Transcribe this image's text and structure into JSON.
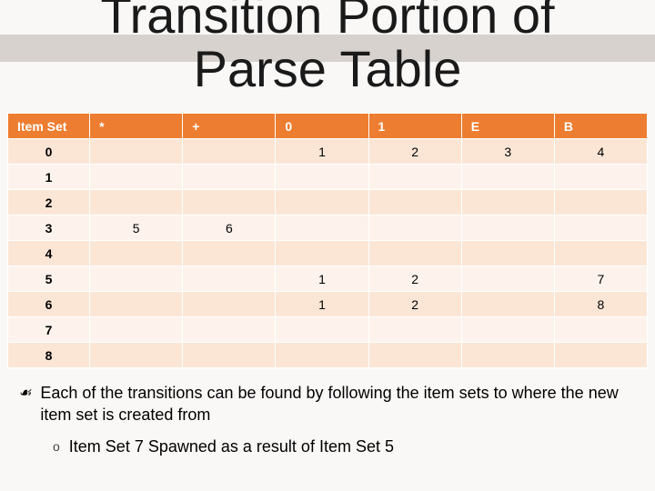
{
  "title_line1": "Transition Portion of",
  "title_line2": "Parse Table",
  "table": {
    "headers": [
      "Item Set",
      "*",
      "+",
      "0",
      "1",
      "E",
      "B"
    ],
    "rows": [
      {
        "label": "0",
        "cells": [
          "",
          "",
          "1",
          "2",
          "3",
          "4"
        ]
      },
      {
        "label": "1",
        "cells": [
          "",
          "",
          "",
          "",
          "",
          ""
        ]
      },
      {
        "label": "2",
        "cells": [
          "",
          "",
          "",
          "",
          "",
          ""
        ]
      },
      {
        "label": "3",
        "cells": [
          "5",
          "6",
          "",
          "",
          "",
          ""
        ]
      },
      {
        "label": "4",
        "cells": [
          "",
          "",
          "",
          "",
          "",
          ""
        ]
      },
      {
        "label": "5",
        "cells": [
          "",
          "",
          "1",
          "2",
          "",
          "7"
        ]
      },
      {
        "label": "6",
        "cells": [
          "",
          "",
          "1",
          "2",
          "",
          "8"
        ]
      },
      {
        "label": "7",
        "cells": [
          "",
          "",
          "",
          "",
          "",
          ""
        ]
      },
      {
        "label": "8",
        "cells": [
          "",
          "",
          "",
          "",
          "",
          ""
        ]
      }
    ]
  },
  "bullets": {
    "b1_icon": "☙",
    "b1_text": "Each of the transitions can be found by following the item sets to where the new item set is created from",
    "b2_icon": "o",
    "b2_text": "Item Set 7 Spawned as a result of Item Set 5"
  },
  "chart_data": {
    "type": "table",
    "title": "Transition Portion of Parse Table",
    "columns": [
      "Item Set",
      "*",
      "+",
      "0",
      "1",
      "E",
      "B"
    ],
    "rows": [
      [
        "0",
        null,
        null,
        1,
        2,
        3,
        4
      ],
      [
        "1",
        null,
        null,
        null,
        null,
        null,
        null
      ],
      [
        "2",
        null,
        null,
        null,
        null,
        null,
        null
      ],
      [
        "3",
        5,
        6,
        null,
        null,
        null,
        null
      ],
      [
        "4",
        null,
        null,
        null,
        null,
        null,
        null
      ],
      [
        "5",
        null,
        null,
        1,
        2,
        null,
        7
      ],
      [
        "6",
        null,
        null,
        1,
        2,
        null,
        8
      ],
      [
        "7",
        null,
        null,
        null,
        null,
        null,
        null
      ],
      [
        "8",
        null,
        null,
        null,
        null,
        null,
        null
      ]
    ]
  }
}
